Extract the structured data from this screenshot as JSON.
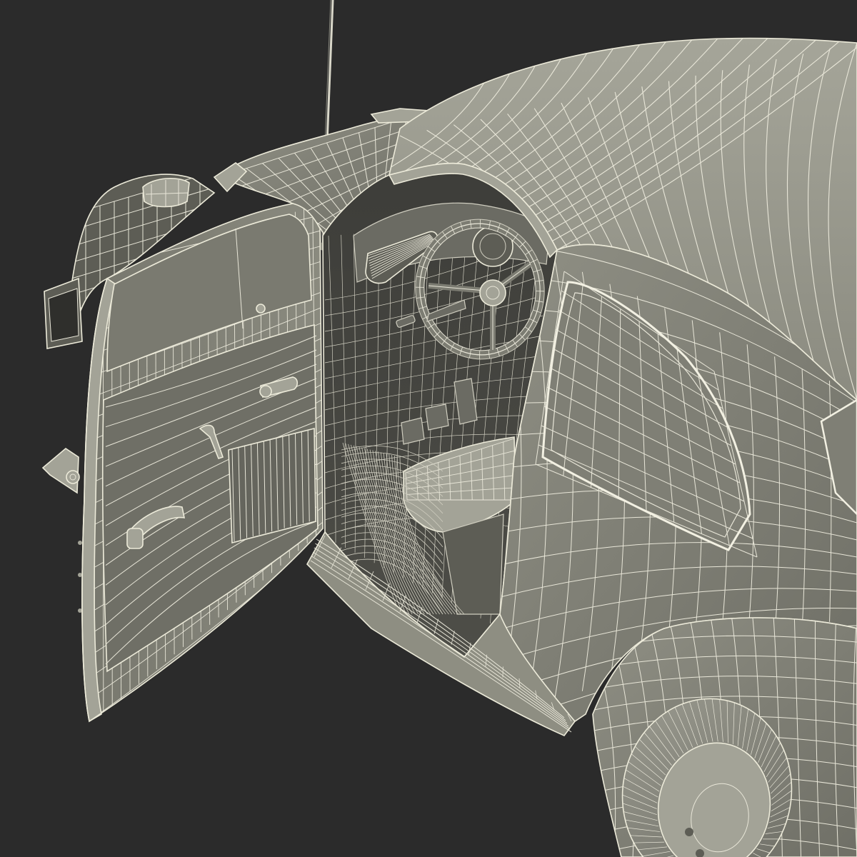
{
  "scene": {
    "subject": "car-wireframe-render",
    "colors": {
      "background": "#2b2b2b",
      "surface": "#8e8e82",
      "surface_light": "#a3a397",
      "surface_dark": "#5d5d55",
      "interior": "#3a3a36",
      "interior_mid": "#4b4b46",
      "wire": "#e8e6d8",
      "wire_dim": "#cfcdbf"
    }
  }
}
